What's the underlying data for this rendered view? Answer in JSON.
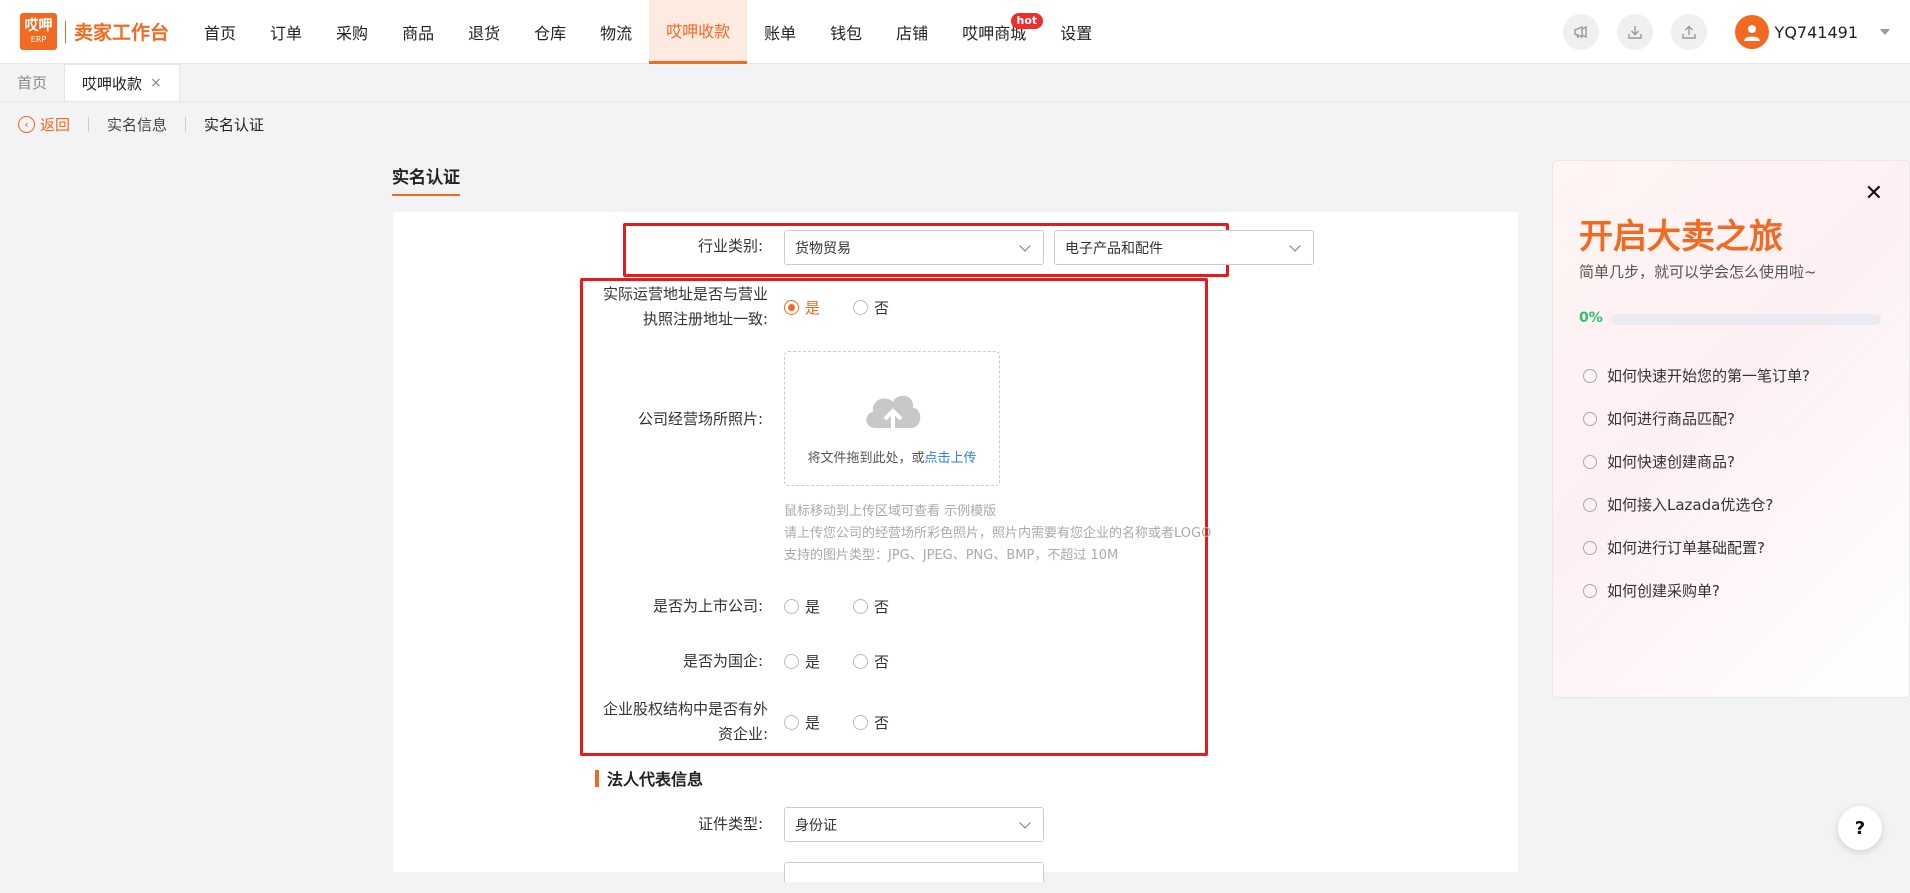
{
  "brand": {
    "logo_line1": "哎呷",
    "logo_line2": "ERP",
    "name": "卖家工作台"
  },
  "nav": {
    "items": [
      {
        "label": "首页"
      },
      {
        "label": "订单"
      },
      {
        "label": "采购"
      },
      {
        "label": "商品"
      },
      {
        "label": "退货"
      },
      {
        "label": "仓库"
      },
      {
        "label": "物流"
      },
      {
        "label": "哎呷收款"
      },
      {
        "label": "账单"
      },
      {
        "label": "钱包"
      },
      {
        "label": "店铺"
      },
      {
        "label": "哎呷商城"
      },
      {
        "label": "设置"
      }
    ],
    "active_label": "哎呷收款",
    "hot_badge": "hot"
  },
  "user": {
    "name": "YQ741491"
  },
  "tabs": [
    {
      "label": "首页"
    },
    {
      "label": "哎呷收款"
    }
  ],
  "tab_close": "×",
  "breadcrumb": {
    "back": "返回",
    "item1": "实名信息",
    "item2": "实名认证"
  },
  "section_title": "实名认证",
  "form": {
    "industry": {
      "label": "行业类别:",
      "value1": "货物贸易",
      "value2": "电子产品和配件"
    },
    "address_same": {
      "label_line1": "实际运营地址是否与营业",
      "label_line2": "执照注册地址一致:",
      "yes": "是",
      "no": "否",
      "selected": "是"
    },
    "photo": {
      "label": "公司经营场所照片:",
      "upload_text": "将文件拖到此处，或",
      "upload_link": "点击上传",
      "hint1": "鼠标移动到上传区域可查看 示例模版",
      "hint2": "请上传您公司的经营场所彩色照片，照片内需要有您企业的名称或者LOGO",
      "hint3": "支持的图片类型：JPG、JPEG、PNG、BMP，不超过 10M"
    },
    "listed": {
      "label": "是否为上市公司:",
      "yes": "是",
      "no": "否"
    },
    "state_owned": {
      "label": "是否为国企:",
      "yes": "是",
      "no": "否"
    },
    "foreign": {
      "label_line1": "企业股权结构中是否有外",
      "label_line2": "资企业:",
      "yes": "是",
      "no": "否"
    },
    "legal_section": "法人代表信息",
    "id_type": {
      "label": "证件类型:",
      "value": "身份证"
    }
  },
  "guide": {
    "title": "开启大卖之旅",
    "subtitle": "简单几步，就可以学会怎么使用啦~",
    "progress_text": "0%",
    "progress": 0,
    "items": [
      {
        "label": "如何快速开始您的第一笔订单?"
      },
      {
        "label": "如何进行商品匹配?"
      },
      {
        "label": "如何快速创建商品?"
      },
      {
        "label": "如何接入Lazada优选仓?"
      },
      {
        "label": "如何进行订单基础配置?"
      },
      {
        "label": "如何创建采购单?"
      }
    ],
    "close": "✕"
  },
  "help": "?",
  "colors": {
    "accent": "#f26a21",
    "highlight_box": "#e61a1a",
    "progress": "#2bc46a",
    "link": "#2a7fe6"
  },
  "icons": [
    "announce-icon",
    "download-icon",
    "upload-icon",
    "avatar-icon",
    "cloud-upload-icon",
    "back-arrow-icon"
  ]
}
